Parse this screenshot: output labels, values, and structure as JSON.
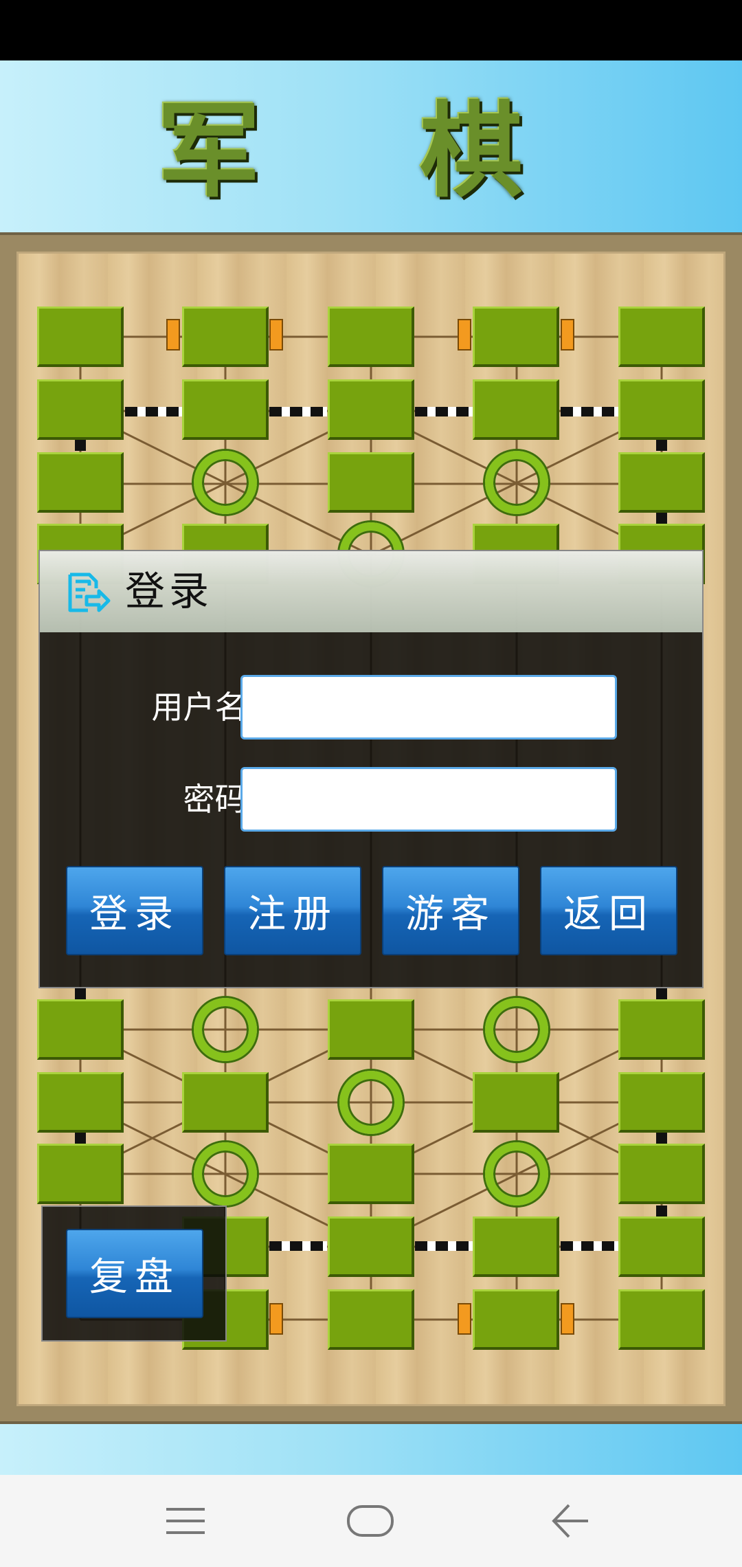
{
  "app": {
    "title": "军 棋"
  },
  "login_dialog": {
    "title": "登录",
    "username_label": "用户名:",
    "username_value": "",
    "password_label": "密码:",
    "password_value": "",
    "buttons": {
      "login": "登录",
      "register": "注册",
      "guest": "游客",
      "back": "返回"
    }
  },
  "replay_button": "复盘",
  "colors": {
    "tile_green": "#77a30e",
    "ring_green": "#86c21c",
    "button_blue": "#2f86d6",
    "board_wood": "#dcc08d"
  },
  "icons": {
    "dialog": "login-document-icon",
    "nav_menu": "menu-icon",
    "nav_home": "home-icon",
    "nav_back": "back-icon"
  }
}
